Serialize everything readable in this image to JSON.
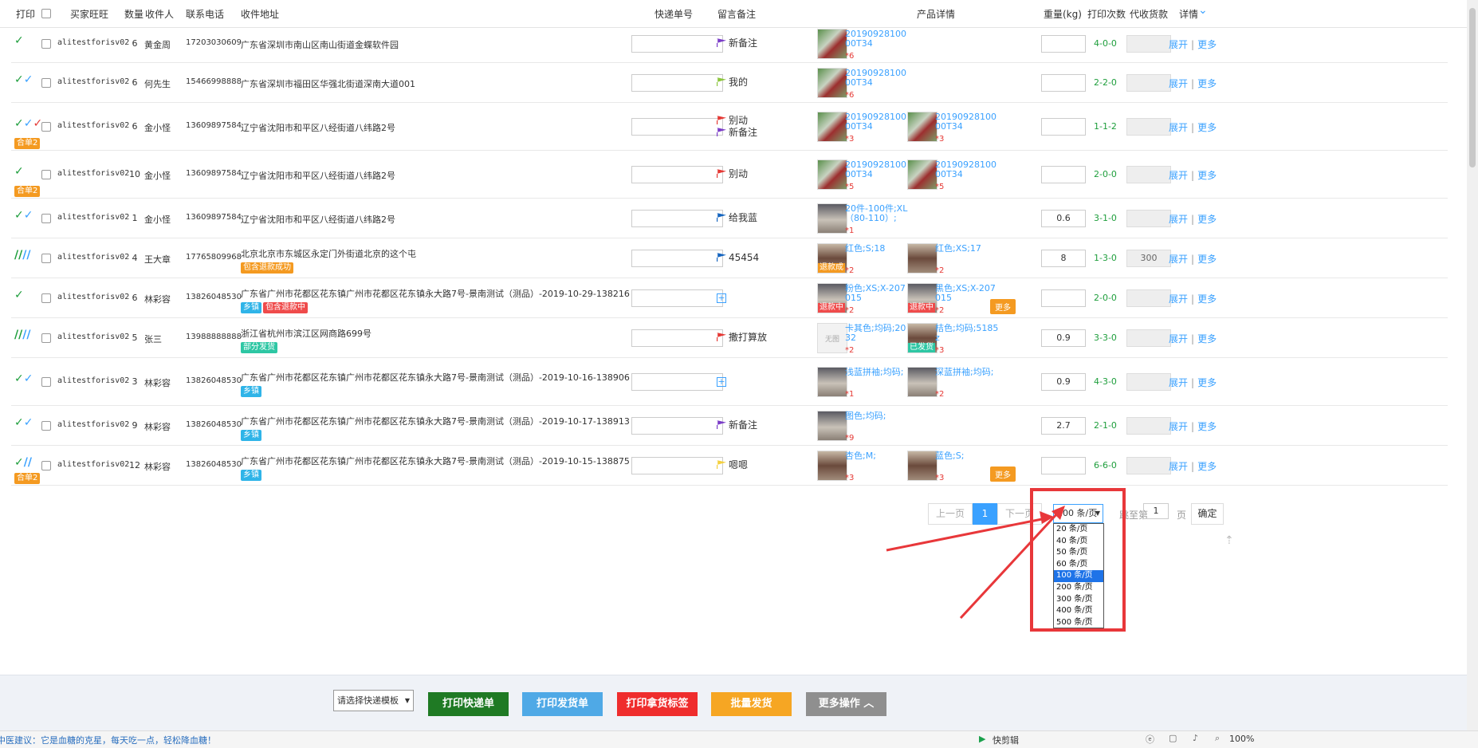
{
  "headers": {
    "print": "打印",
    "buyer": "买家旺旺",
    "qty": "数量",
    "recv": "收件人",
    "phone": "联系电话",
    "addr": "收件地址",
    "ship": "快递单号",
    "note": "留言备注",
    "product": "产品详情",
    "weight": "重量(kg)",
    "count": "打印次数",
    "cod": "代收货款",
    "detail": "详情"
  },
  "rows": [
    {
      "buyer": "alitestforisv02",
      "qty": "6",
      "recv": "黄金周",
      "phone": "17203030609",
      "addr": "广东省深圳市南山区南山街道金蝶软件园",
      "note1": "新备注",
      "p1": "2019092810000T34",
      "p1q": "*6",
      "weight": "",
      "count": "4-0-0",
      "cod": "",
      "tag": "",
      "tag2": "",
      "hd": ""
    },
    {
      "buyer": "alitestforisv02",
      "qty": "6",
      "recv": "何先生",
      "phone": "15466998888",
      "addr": "广东省深圳市福田区华强北街道深南大道001",
      "note1": "我的",
      "p1": "2019092810000T34",
      "p1q": "*6",
      "weight": "",
      "count": "2-2-0",
      "cod": "",
      "tag": "",
      "tag2": "",
      "hd": ""
    },
    {
      "buyer": "alitestforisv02",
      "qty": "6",
      "recv": "金小怪",
      "phone": "13609897584",
      "addr": "辽宁省沈阳市和平区八经街道八纬路2号",
      "note1": "别动",
      "note2": "新备注",
      "p1": "2019092810000T34",
      "p1q": "*3",
      "p2": "2019092810000T34",
      "p2q": "*3",
      "weight": "",
      "count": "1-1-2",
      "cod": "",
      "tag": "",
      "tag2": "",
      "hd": "合单2"
    },
    {
      "buyer": "alitestforisv02",
      "qty": "10",
      "recv": "金小怪",
      "phone": "13609897584",
      "addr": "辽宁省沈阳市和平区八经街道八纬路2号",
      "note1": "别动",
      "p1": "2019092810000T34",
      "p1q": "*5",
      "p2": "2019092810000T34",
      "p2q": "*5",
      "weight": "",
      "count": "2-0-0",
      "cod": "",
      "tag": "",
      "tag2": "",
      "hd": "合单2"
    },
    {
      "buyer": "alitestforisv02",
      "qty": "1",
      "recv": "金小怪",
      "phone": "13609897584",
      "addr": "辽宁省沈阳市和平区八经街道八纬路2号",
      "note1": "给我蓝",
      "p1": "20件-100件;XL（80-110）;",
      "p1q": "*1",
      "weight": "0.6",
      "count": "3-1-0",
      "cod": "",
      "tag": "",
      "tag2": "",
      "hd": ""
    },
    {
      "buyer": "alitestforisv02",
      "qty": "4",
      "recv": "王大章",
      "phone": "17765809968",
      "addr": "北京北京市东城区永定门外街道北京的这个屯",
      "note1": "45454",
      "p1": "红色;S;18",
      "p1q": "*2",
      "p1b": "退款成",
      "p2": "红色;XS;17",
      "p2q": "*2",
      "weight": "8",
      "count": "1-3-0",
      "cod": "300",
      "tag": "包含退款成功",
      "tag2": "",
      "hd": ""
    },
    {
      "buyer": "alitestforisv02",
      "qty": "6",
      "recv": "林彩容",
      "phone": "13826048530",
      "addr": "广东省广州市花都区花东镇广州市花都区花东镇永大路7号-景南测试（测品）-2019-10-29-138216",
      "note1": "",
      "p1": "粉色;XS;X-207015",
      "p1q": "*2",
      "p1b": "退款中",
      "p2": "黑色;XS;X-207015",
      "p2q": "*2",
      "p2b": "退款中",
      "weight": "",
      "count": "2-0-0",
      "cod": "",
      "tag": "乡镇",
      "tag2": "包含退款中",
      "hd": "",
      "more": "更多"
    },
    {
      "buyer": "alitestforisv02",
      "qty": "5",
      "recv": "张三",
      "phone": "13988888888",
      "addr": "浙江省杭州市滨江区网商路699号",
      "note1": "撒打算放",
      "p1": "卡其色;均码;2032",
      "p1q": "*2",
      "p2": "桔色;均码;5185z",
      "p2q": "*3",
      "p2b": "已发货",
      "weight": "0.9",
      "count": "3-3-0",
      "cod": "",
      "tag": "部分发货",
      "tag2": "",
      "hd": ""
    },
    {
      "buyer": "alitestforisv02",
      "qty": "3",
      "recv": "林彩容",
      "phone": "13826048530",
      "addr": "广东省广州市花都区花东镇广州市花都区花东镇永大路7号-景南测试（测品）-2019-10-16-138906",
      "note1": "",
      "p1": "浅蓝拼袖;均码;",
      "p1q": "*1",
      "p2": "深蓝拼袖;均码;",
      "p2q": "*2",
      "weight": "0.9",
      "count": "4-3-0",
      "cod": "",
      "tag": "乡镇",
      "tag2": "",
      "hd": ""
    },
    {
      "buyer": "alitestforisv02",
      "qty": "9",
      "recv": "林彩容",
      "phone": "13826048530",
      "addr": "广东省广州市花都区花东镇广州市花都区花东镇永大路7号-景南测试（测品）-2019-10-17-138913",
      "note1": "新备注",
      "p1": "图色;均码;",
      "p1q": "*9",
      "weight": "2.7",
      "count": "2-1-0",
      "cod": "",
      "tag": "乡镇",
      "tag2": "",
      "hd": ""
    },
    {
      "buyer": "alitestforisv02",
      "qty": "12",
      "recv": "林彩容",
      "phone": "13826048530",
      "addr": "广东省广州市花都区花东镇广州市花都区花东镇永大路7号-景南测试（测品）-2019-10-15-138875",
      "note1": "嗯嗯",
      "p1": "杏色;M;",
      "p1q": "*3",
      "p2": "蓝色;S;",
      "p2q": "*3",
      "weight": "",
      "count": "6-6-0",
      "cod": "",
      "tag": "乡镇",
      "tag2": "",
      "hd": "合单2",
      "more": "更多"
    }
  ],
  "actions": {
    "expand": "展开",
    "sep": "|",
    "more": "更多"
  },
  "pagination": {
    "prev": "上一页",
    "current": "1",
    "next": "下一页",
    "per_page": "100 条/页",
    "goto_prefix": "跳至第",
    "goto_value": "1",
    "goto_suffix": "页",
    "confirm": "确定"
  },
  "per_page_options": [
    "20 条/页",
    "40 条/页",
    "50 条/页",
    "60 条/页",
    "100 条/页",
    "200 条/页",
    "300 条/页",
    "400 条/页",
    "500 条/页"
  ],
  "bottom": {
    "template_select": "请选择快递模板",
    "print_express": "打印快递单",
    "print_delivery": "打印发货单",
    "print_tag": "打印拿货标签",
    "batch_ship": "批量发货",
    "more_ops": "更多操作"
  },
  "status": {
    "tip": "中医建议：它是血糖的克星，每天吃一点，轻松降血糖！",
    "kuaijian": "快剪辑",
    "zoom": "100%"
  },
  "nosuo": "无图",
  "colors": {
    "accent": "#3aa1ff",
    "green_btn": "#1f7a24",
    "blue_btn": "#4fa9e6",
    "red_btn": "#ef2d2d",
    "orange_btn": "#f6a623",
    "gray_btn": "#8f8f8f",
    "highlight_red": "#e8373a"
  }
}
